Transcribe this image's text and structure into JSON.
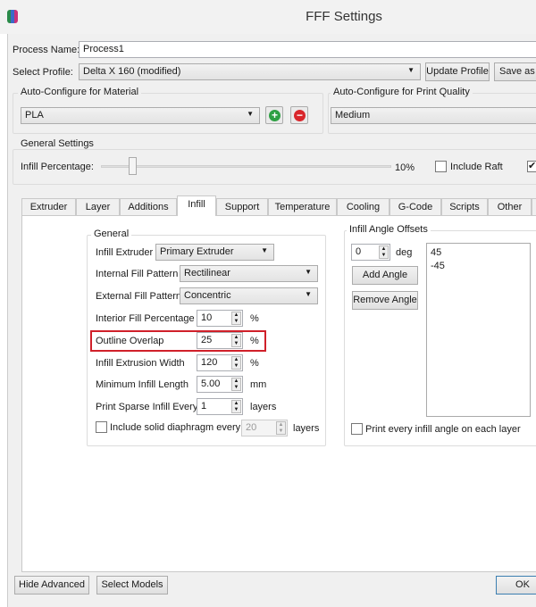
{
  "window": {
    "title": "FFF Settings"
  },
  "process_name": {
    "label": "Process Name:",
    "value": "Process1"
  },
  "select_profile": {
    "label": "Select Profile:",
    "value": "Delta X 160 (modified)",
    "update_label": "Update Profile",
    "save_as_label": "Save as"
  },
  "material": {
    "title": "Auto-Configure for Material",
    "value": "PLA"
  },
  "quality": {
    "title": "Auto-Configure for Print Quality",
    "value": "Medium"
  },
  "general_settings": {
    "title": "General Settings",
    "infill_label": "Infill Percentage:",
    "infill_value": "10%",
    "infill_fraction": 0.1,
    "include_raft_label": "Include Raft",
    "include_raft": false,
    "other_checked": true
  },
  "tabs": [
    "Extruder",
    "Layer",
    "Additions",
    "Infill",
    "Support",
    "Temperature",
    "Cooling",
    "G-Code",
    "Scripts",
    "Other"
  ],
  "active_tab": "Infill",
  "infill": {
    "group_title": "General",
    "extruder_label": "Infill Extruder",
    "extruder_value": "Primary Extruder",
    "internal_label": "Internal Fill Pattern",
    "internal_value": "Rectilinear",
    "external_label": "External Fill Pattern",
    "external_value": "Concentric",
    "rows": [
      {
        "label": "Interior Fill Percentage",
        "value": "10",
        "unit": "%"
      },
      {
        "label": "Outline Overlap",
        "value": "25",
        "unit": "%"
      },
      {
        "label": "Infill Extrusion Width",
        "value": "120",
        "unit": "%"
      },
      {
        "label": "Minimum Infill Length",
        "value": "5.00",
        "unit": "mm"
      },
      {
        "label": "Print Sparse Infill Every",
        "value": "1",
        "unit": "layers"
      }
    ],
    "diaphragm_label": "Include solid diaphragm every",
    "diaphragm_value": "20",
    "diaphragm_unit": "layers"
  },
  "angles": {
    "title": "Infill Angle Offsets",
    "value": "0",
    "unit": "deg",
    "add_label": "Add Angle",
    "remove_label": "Remove Angle",
    "list": [
      "45",
      "-45"
    ],
    "print_every_label": "Print every infill angle on each layer"
  },
  "footer": {
    "hide_advanced": "Hide Advanced",
    "select_models": "Select Models",
    "ok": "OK"
  },
  "colors": {
    "highlight": "#d0202a"
  }
}
